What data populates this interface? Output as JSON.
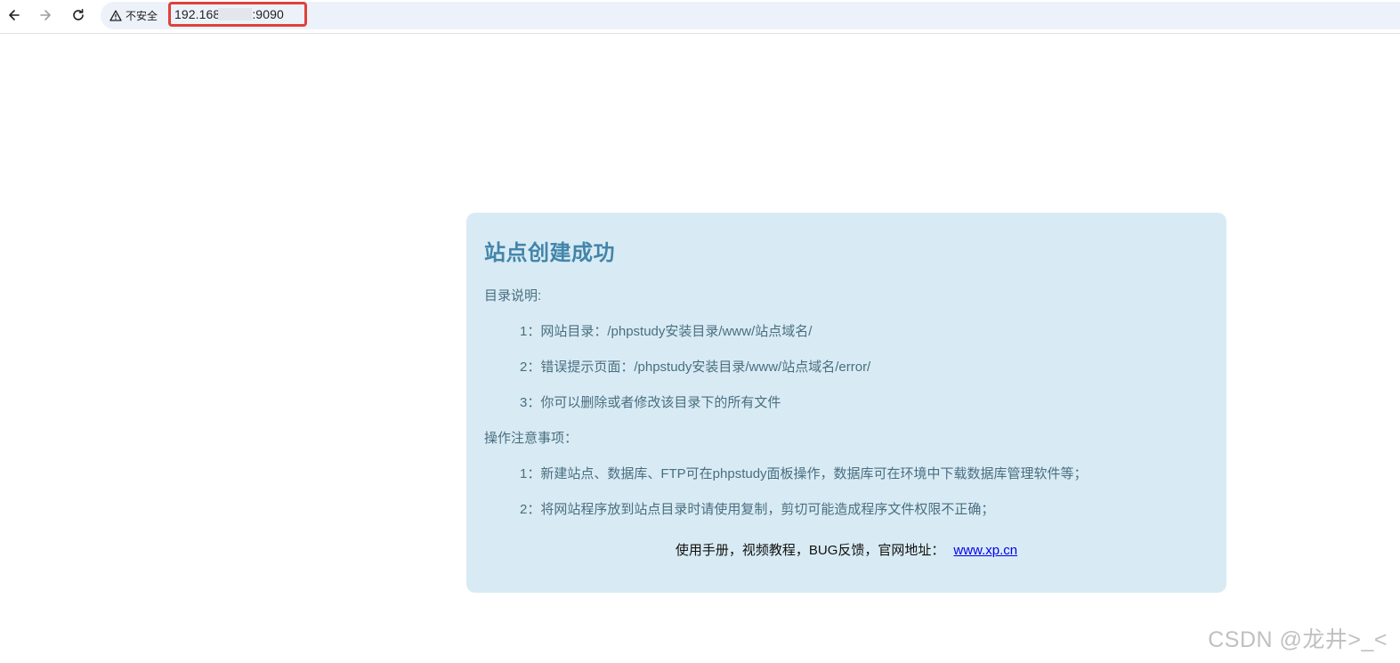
{
  "browser": {
    "security_label": "不安全",
    "url_prefix": "192.168",
    "url_suffix": ":9090"
  },
  "card": {
    "title": "站点创建成功",
    "dir_heading": "目录说明:",
    "dir_items": [
      "1：网站目录：/phpstudy安装目录/www/站点域名/",
      "2：错误提示页面：/phpstudy安装目录/www/站点域名/error/",
      "3：你可以删除或者修改该目录下的所有文件"
    ],
    "ops_heading": "操作注意事项：",
    "ops_items": [
      "1：新建站点、数据库、FTP可在phpstudy面板操作，数据库可在环境中下载数据库管理软件等；",
      "2：将网站程序放到站点目录时请使用复制，剪切可能造成程序文件权限不正确；"
    ],
    "footer_text": "使用手册，视频教程，BUG反馈，官网地址：",
    "footer_link": "www.xp.cn"
  },
  "watermark": "CSDN @龙井>_<"
}
